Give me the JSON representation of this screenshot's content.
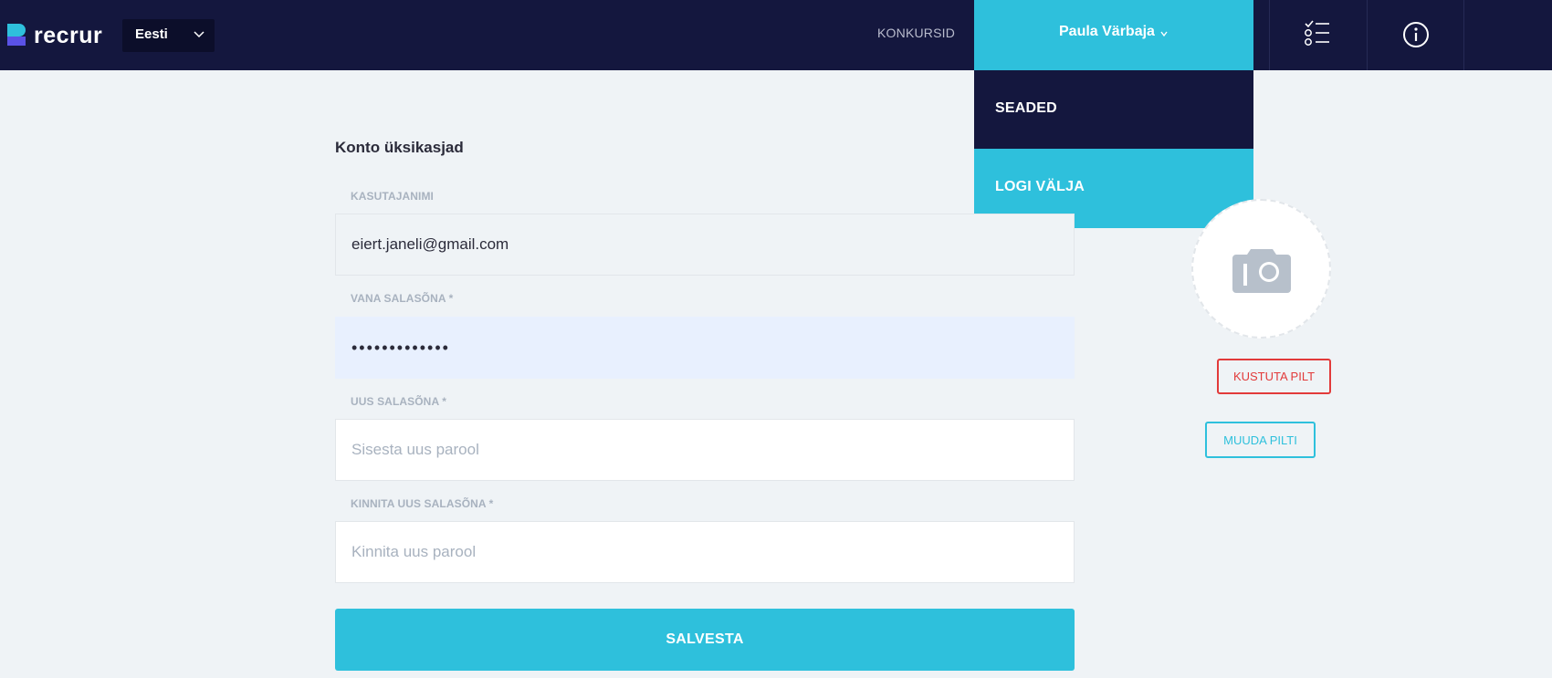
{
  "app": {
    "brand_name": "recrur"
  },
  "header": {
    "language": "Eesti",
    "nav_contests": "KONKURSID",
    "user_name": "Paula Värbaja",
    "icons": {
      "tasks": "checklist-icon",
      "info": "info-icon",
      "language_chevron": "chevron-down-icon",
      "user_chevron": "chevron-down-icon"
    }
  },
  "user_dropdown": {
    "items": [
      {
        "label": "SEADED"
      },
      {
        "label": "LOGI VÄLJA"
      }
    ]
  },
  "form": {
    "title": "Konto üksikasjad",
    "username": {
      "label": "KASUTAJANIMI",
      "value": "eiert.janeli@gmail.com"
    },
    "old_password": {
      "label": "VANA SALASÕNA *",
      "value": "•••••••••••••"
    },
    "new_password": {
      "label": "UUS SALASÕNA *",
      "placeholder": "Sisesta uus parool"
    },
    "confirm_password": {
      "label": "KINNITA UUS SALASÕNA *",
      "placeholder": "Kinnita uus parool"
    },
    "save_label": "SALVESTA"
  },
  "avatar": {
    "icon": "camera-icon",
    "delete_label": "KUSTUTA PILT",
    "change_label": "MUUDA PILTI"
  },
  "colors": {
    "navbar": "#14173e",
    "accent": "#2ec0dc",
    "danger": "#e23a3a",
    "background": "#eff3f6"
  }
}
